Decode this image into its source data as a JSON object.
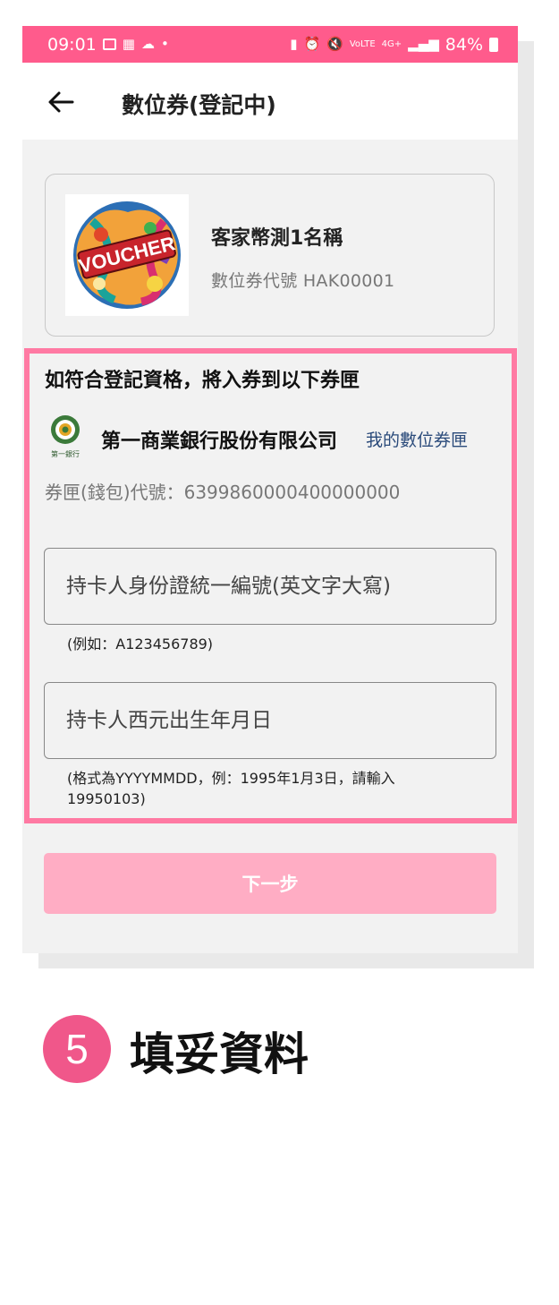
{
  "status_bar": {
    "time": "09:01",
    "battery_percent": "84%",
    "network_label": "4G+",
    "left_icons": [
      "gallery-icon",
      "qr-icon",
      "cloud-icon",
      "dot-icon"
    ],
    "right_icons": [
      "nfc-icon",
      "alarm-icon",
      "mute-icon",
      "volte-icon",
      "data-arrows-icon",
      "signal-icon",
      "battery-icon"
    ]
  },
  "header": {
    "title": "數位券(登記中)",
    "back_icon": "back-arrow-icon"
  },
  "voucher": {
    "image_label": "VOUCHER",
    "name": "客家幣測1名稱",
    "code_text": "數位券代號 HAK00001"
  },
  "registration": {
    "qualify_text": "如符合登記資格，將入券到以下券匣",
    "bank_name": "第一商業銀行股份有限公司",
    "bank_logo_caption": "第一銀行",
    "my_wallet_link": "我的數位券匣",
    "wallet_code_text": "券匣(錢包)代號：6399860000400000000",
    "id_input": {
      "placeholder": "持卡人身份證統一編號(英文字大寫)",
      "value": "",
      "hint": "(例如：A123456789)"
    },
    "dob_input": {
      "placeholder": "持卡人西元出生年月日",
      "value": "",
      "hint": "(格式為YYYYMMDD，例：1995年1月3日，請輸入19950103)"
    },
    "next_button": "下一步"
  },
  "step": {
    "number": "5",
    "title": "填妥資料"
  },
  "colors": {
    "brand_pink": "#ff5b8c",
    "highlight_border": "#ff7aa3",
    "button_disabled_pink": "#ffadc4",
    "step_badge": "#f0578a",
    "link_blue": "#2a4a7a"
  }
}
